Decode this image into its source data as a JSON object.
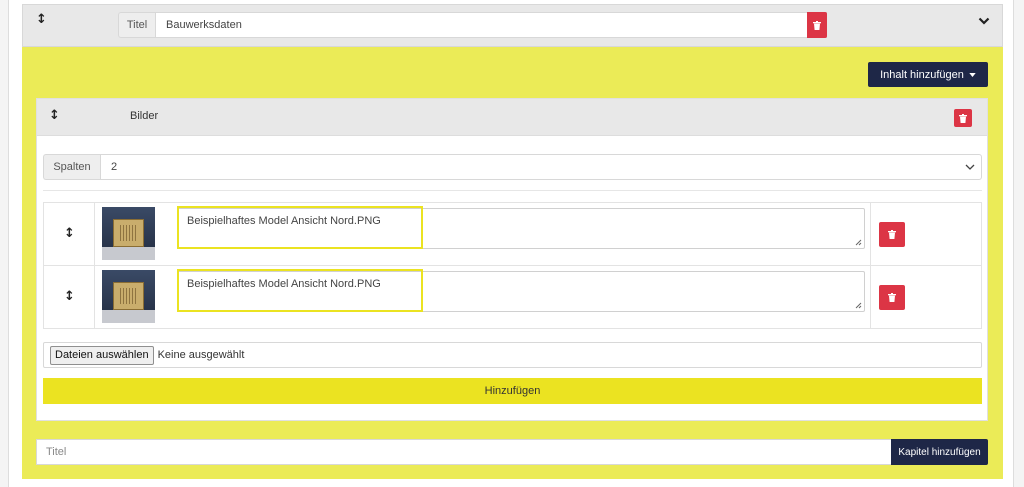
{
  "chapter": {
    "title_addon": "Titel",
    "title_value": "Bauwerksdaten",
    "add_content_label": "Inhalt hinzufügen"
  },
  "block": {
    "title": "Bilder",
    "columns_label": "Spalten",
    "columns_value": "2",
    "images": [
      {
        "caption": "Beispielhaftes Model Ansicht Nord.PNG"
      },
      {
        "caption": "Beispielhaftes Model Ansicht Nord.PNG"
      }
    ],
    "file_button_label": "Dateien auswählen",
    "file_status": "Keine ausgewählt",
    "add_button_label": "Hinzufügen"
  },
  "new_chapter": {
    "placeholder": "Titel",
    "button_label": "Kapitel hinzufügen"
  },
  "colors": {
    "accent_yellow": "#ebe321",
    "chapter_body": "#ebeb57",
    "dark_button": "#1e2747",
    "danger": "#dc3545"
  },
  "icons": [
    "drag-handle-icon",
    "trash-icon",
    "chevron-down-icon",
    "caret-down-icon",
    "resize-grip-icon"
  ]
}
